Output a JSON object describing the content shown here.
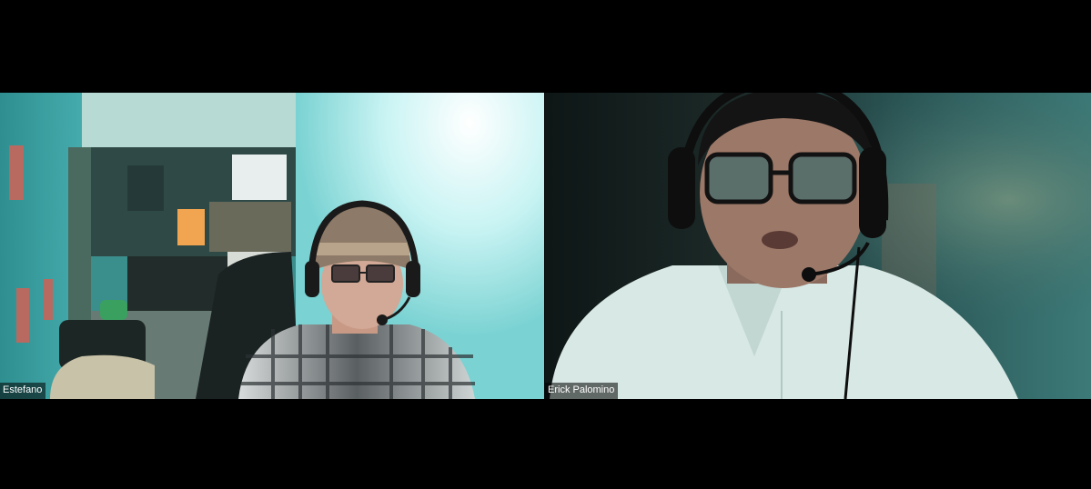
{
  "participants": [
    {
      "name": "Estefano",
      "role": "participant-video",
      "background_color": "#5fc0c0"
    },
    {
      "name": "Erick Palomino",
      "role": "participant-video",
      "background_color": "#1e3232"
    }
  ]
}
